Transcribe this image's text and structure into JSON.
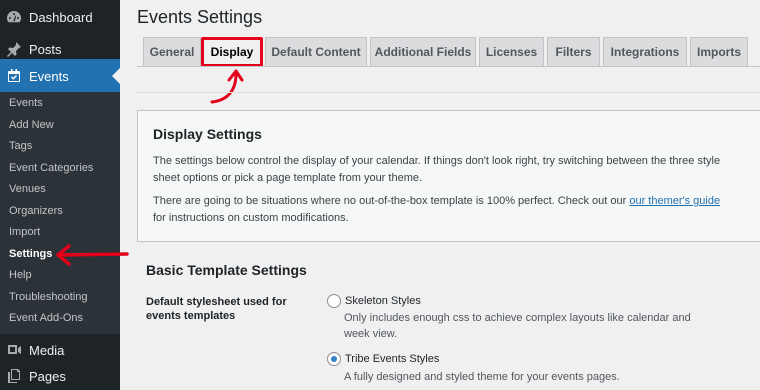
{
  "sidebar": {
    "top_items": [
      {
        "label": "Dashboard",
        "icon": "dashboard-icon"
      },
      {
        "label": "Posts",
        "icon": "pushpin-icon"
      },
      {
        "label": "Events",
        "icon": "calendar-icon"
      },
      {
        "label": "Media",
        "icon": "media-icon"
      },
      {
        "label": "Pages",
        "icon": "pages-icon"
      }
    ],
    "submenu": [
      "Events",
      "Add New",
      "Tags",
      "Event Categories",
      "Venues",
      "Organizers",
      "Import",
      "Settings",
      "Help",
      "Troubleshooting",
      "Event Add-Ons"
    ],
    "current_submenu": "Settings"
  },
  "page": {
    "title": "Events Settings"
  },
  "tabs": [
    "General",
    "Display",
    "Default Content",
    "Additional Fields",
    "Licenses",
    "Filters",
    "Integrations",
    "Imports"
  ],
  "active_tab": "Display",
  "display_box": {
    "heading": "Display Settings",
    "para1": "The settings below control the display of your calendar. If things don't look right, try switching between the three style sheet options or pick a page template from your theme.",
    "para2_before": "There are going to be situations where no out-of-the-box template is 100% perfect. Check out our ",
    "para2_link": "our themer's guide",
    "para2_after": " for instructions on custom modifications."
  },
  "template_settings": {
    "heading": "Basic Template Settings",
    "stylesheet_label": "Default stylesheet used for events templates",
    "options": [
      {
        "label": "Skeleton Styles",
        "description": "Only includes enough css to achieve complex layouts like calendar and week view.",
        "checked": false
      },
      {
        "label": "Tribe Events Styles",
        "description": "A fully designed and styled theme for your events pages.",
        "checked": true
      }
    ]
  },
  "colors": {
    "sidebar_bg": "#1d2327",
    "submenu_bg": "#2c3338",
    "active_menu": "#2271b1",
    "annotation": "#e2001a",
    "link": "#2271b1"
  }
}
